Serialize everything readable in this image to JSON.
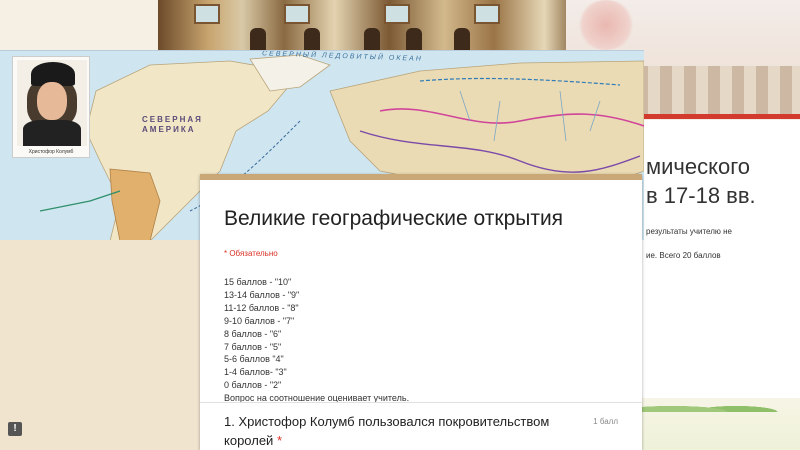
{
  "map": {
    "ocean_label": "СЕВЕРНЫЙ ЛЕДОВИТЫЙ ОКЕАН",
    "continent_label": [
      "СЕВЕРНАЯ",
      "АМЕРИКА"
    ],
    "portrait_caption": "Христофор Колумб"
  },
  "slide2": {
    "title_line1": "мического",
    "title_line2": "в 17-18 вв.",
    "text_line1": "результаты учителю не",
    "text_line2": "ие. Всего 20 баллов"
  },
  "form": {
    "title": "Великие географические открытия",
    "required_note": "* Обязательно",
    "scores": [
      "15 баллов - \"10\"",
      "13-14 баллов - \"9\"",
      "11-12 баллов - \"8\"",
      "9-10 баллов - \"7\"",
      "8 баллов - \"6\"",
      "7 баллов - \"5\"",
      "5-6 баллов \"4\"",
      "1-4 баллов- \"3\"",
      "0 баллов - \"2\"",
      "Вопрос на соотношение оценивает учитель."
    ],
    "question": {
      "text": "1. Христофор Колумб пользовался покровительством королей",
      "required_mark": "*",
      "points": "1 балл"
    }
  },
  "feedback_button": {
    "label": "!"
  },
  "colors": {
    "accent": "#c9a777",
    "required": "#d93025",
    "map_water": "#cfe6f1",
    "background": "#f1e4cf"
  }
}
